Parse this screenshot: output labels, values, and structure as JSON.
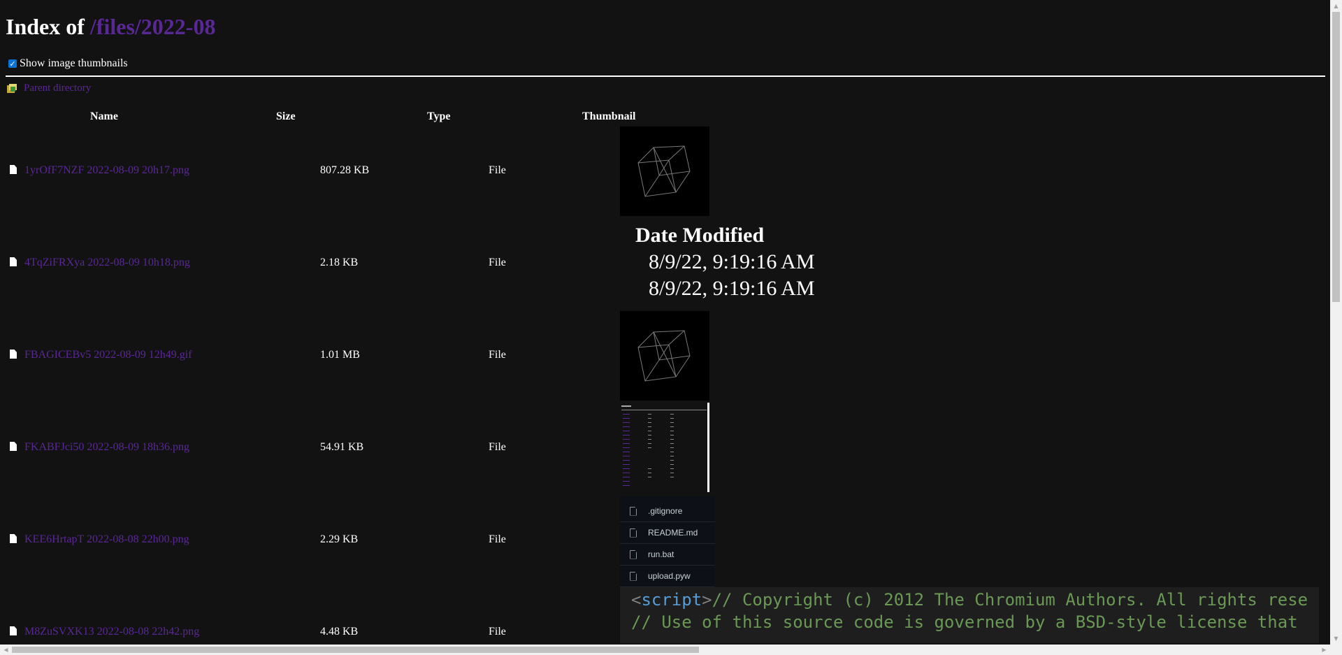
{
  "title": {
    "prefix": "Index of",
    "path": "/files/2022-08"
  },
  "thumb_toggle": {
    "label": "Show image thumbnails",
    "checked": true
  },
  "parent_dir": {
    "label": "Parent directory"
  },
  "columns": {
    "name": "Name",
    "size": "Size",
    "type": "Type",
    "thumbnail": "Thumbnail"
  },
  "files": [
    {
      "name": "1yrOfF7NZF 2022-08-09 20h17.png",
      "size": "807.28 KB",
      "type": "File"
    },
    {
      "name": "4TqZiFRXya 2022-08-09 10h18.png",
      "size": "2.18 KB",
      "type": "File"
    },
    {
      "name": "FBAGICEBv5 2022-08-09 12h49.gif",
      "size": "1.01 MB",
      "type": "File"
    },
    {
      "name": "FKABFJci50 2022-08-09 18h36.png",
      "size": "54.91 KB",
      "type": "File"
    },
    {
      "name": "KEE6HrtapT 2022-08-08 22h00.png",
      "size": "2.29 KB",
      "type": "File"
    },
    {
      "name": "M8ZuSVXK13 2022-08-08 22h42.png",
      "size": "4.48 KB",
      "type": "File"
    }
  ],
  "thumb_date_modified": {
    "title": "Date Modified",
    "values": [
      "8/9/22, 9:19:16 AM",
      "8/9/22, 9:19:16 AM"
    ]
  },
  "thumb_repo_files": [
    ".gitignore",
    "README.md",
    "run.bat",
    "upload.pyw"
  ],
  "thumb_code": {
    "line1_tag_open": "<",
    "line1_keyword": "script",
    "line1_tag_close": ">",
    "line1_comment": "// Copyright (c) 2012 The Chromium Authors. All rights rese",
    "line2": "// Use of this source code is governed by a BSD-style license that"
  },
  "colors": {
    "background": "#121212",
    "link": "#5a2896",
    "text": "#ffffff"
  }
}
